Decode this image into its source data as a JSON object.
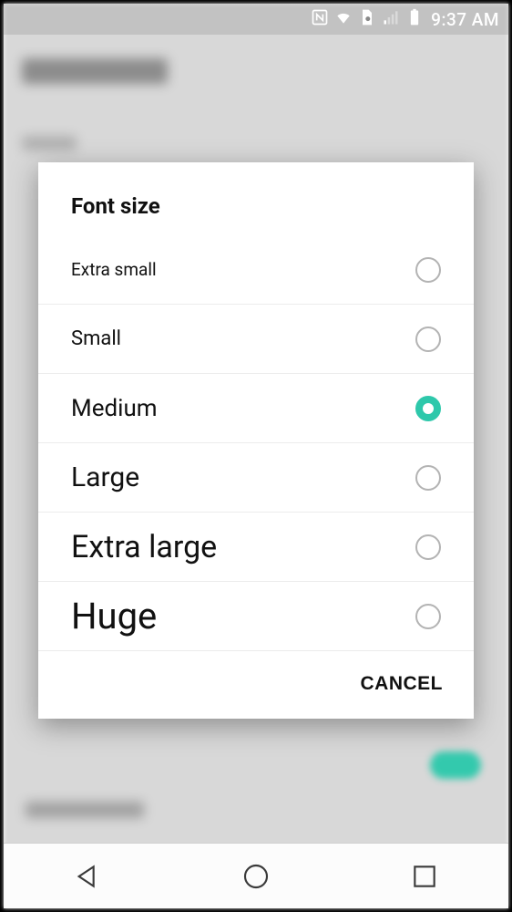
{
  "status": {
    "time": "9:37 AM"
  },
  "dialog": {
    "title": "Font size",
    "cancel": "CANCEL",
    "selected_index": 2,
    "options": [
      {
        "label": "Extra small"
      },
      {
        "label": "Small"
      },
      {
        "label": "Medium"
      },
      {
        "label": "Large"
      },
      {
        "label": "Extra large"
      },
      {
        "label": "Huge"
      }
    ]
  },
  "accent_color": "#2ec8ab"
}
